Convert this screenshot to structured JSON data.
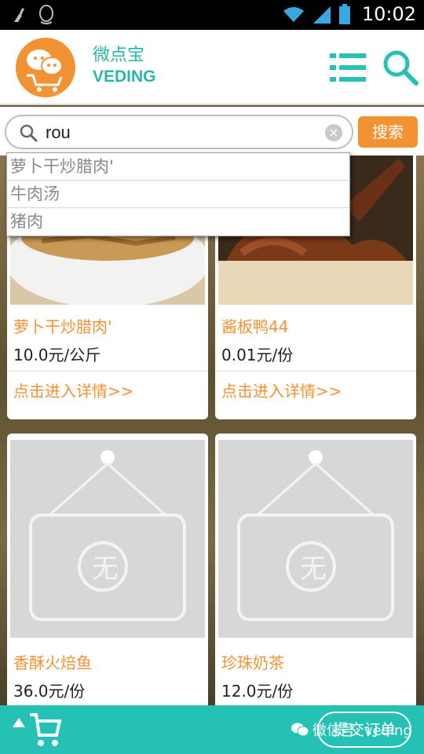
{
  "status_bar": {
    "time": "10:02"
  },
  "header": {
    "brand_cn": "微点宝",
    "brand_en": "VEDING"
  },
  "search": {
    "value": "rou",
    "submit_label": "搜索"
  },
  "suggestions": [
    "萝卜干炒腊肉'",
    "牛肉汤",
    "猪肉"
  ],
  "products": [
    {
      "name": "萝卜干炒腊肉'",
      "price": "10.0元/公斤",
      "link": "点击进入详情>>"
    },
    {
      "name": "酱板鸭44",
      "price": "0.01元/份",
      "link": "点击进入详情>>"
    },
    {
      "name": "香酥火焙鱼",
      "price": "36.0元/份"
    },
    {
      "name": "珍珠奶茶",
      "price": "12.0元/份"
    }
  ],
  "bottom_bar": {
    "submit_label": "提交订单",
    "watermark": "微信号: veding"
  },
  "colors": {
    "accent_orange": "#f39232",
    "brand_teal": "#2cb5ad",
    "bottom_bar": "#24c1b4"
  }
}
